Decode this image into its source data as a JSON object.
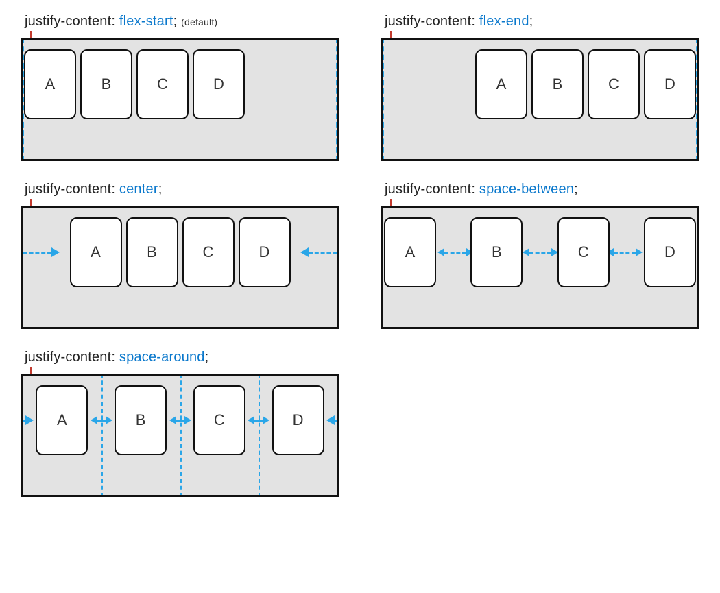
{
  "accent": "#0a78cc",
  "property": "justify-content",
  "boxes": [
    "A",
    "B",
    "C",
    "D"
  ],
  "examples": {
    "flex_start": {
      "value": "flex-start",
      "note": "(default)"
    },
    "flex_end": {
      "value": "flex-end",
      "note": ""
    },
    "center": {
      "value": "center",
      "note": ""
    },
    "space_between": {
      "value": "space-between",
      "note": ""
    },
    "space_around": {
      "value": "space-around",
      "note": ""
    }
  }
}
